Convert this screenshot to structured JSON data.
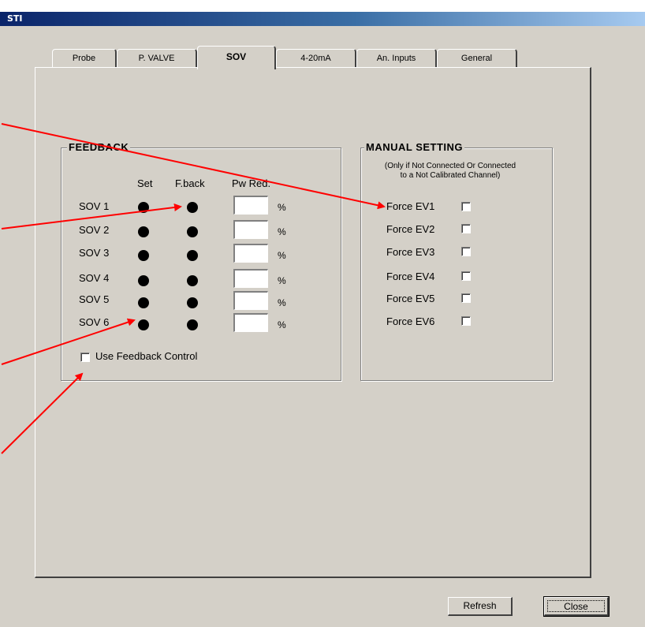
{
  "window": {
    "title": "STI"
  },
  "tabs": [
    {
      "label": "Probe",
      "active": false
    },
    {
      "label": "P. VALVE",
      "active": false
    },
    {
      "label": "SOV",
      "active": true
    },
    {
      "label": "4-20mA",
      "active": false
    },
    {
      "label": "An. Inputs",
      "active": false
    },
    {
      "label": "General",
      "active": false
    }
  ],
  "feedback": {
    "title": "FEEDBACK",
    "col_set": "Set",
    "col_fback": "F.back",
    "col_pwred": "Pw Red.",
    "unit": "%",
    "rows": [
      {
        "label": "SOV 1",
        "value": ""
      },
      {
        "label": "SOV 2",
        "value": ""
      },
      {
        "label": "SOV 3",
        "value": ""
      },
      {
        "label": "SOV 4",
        "value": ""
      },
      {
        "label": "SOV 5",
        "value": ""
      },
      {
        "label": "SOV 6",
        "value": ""
      }
    ],
    "use_feedback_label": "Use Feedback Control"
  },
  "manual": {
    "title": "MANUAL  SETTING",
    "subtitle_line1": "(Only if Not Connected Or Connected",
    "subtitle_line2": "to a Not Calibrated Channel)",
    "items": [
      {
        "label": "Force EV1"
      },
      {
        "label": "Force EV2"
      },
      {
        "label": "Force EV3"
      },
      {
        "label": "Force EV4"
      },
      {
        "label": "Force EV5"
      },
      {
        "label": "Force EV6"
      }
    ]
  },
  "buttons": {
    "refresh": "Refresh",
    "close": "Close"
  },
  "colors": {
    "arrow": "#ff0000",
    "title_gradient_start": "#0a246a"
  }
}
